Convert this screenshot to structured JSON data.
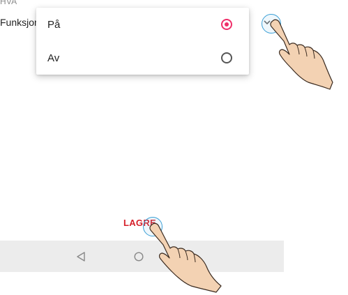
{
  "settings": {
    "section_header": "HVA",
    "row_label": "Funksjon"
  },
  "dropdown": {
    "options": [
      {
        "label": "På",
        "selected": true
      },
      {
        "label": "Av",
        "selected": false
      }
    ],
    "accent_color": "#ef2f69"
  },
  "footer": {
    "save_label": "LAGRE",
    "save_color": "#d6202a"
  },
  "navigation": {
    "icons": [
      "back-triangle-icon",
      "home-circle-icon"
    ]
  },
  "overlay": {
    "tap_indicator_color": "#3a9fd6"
  }
}
